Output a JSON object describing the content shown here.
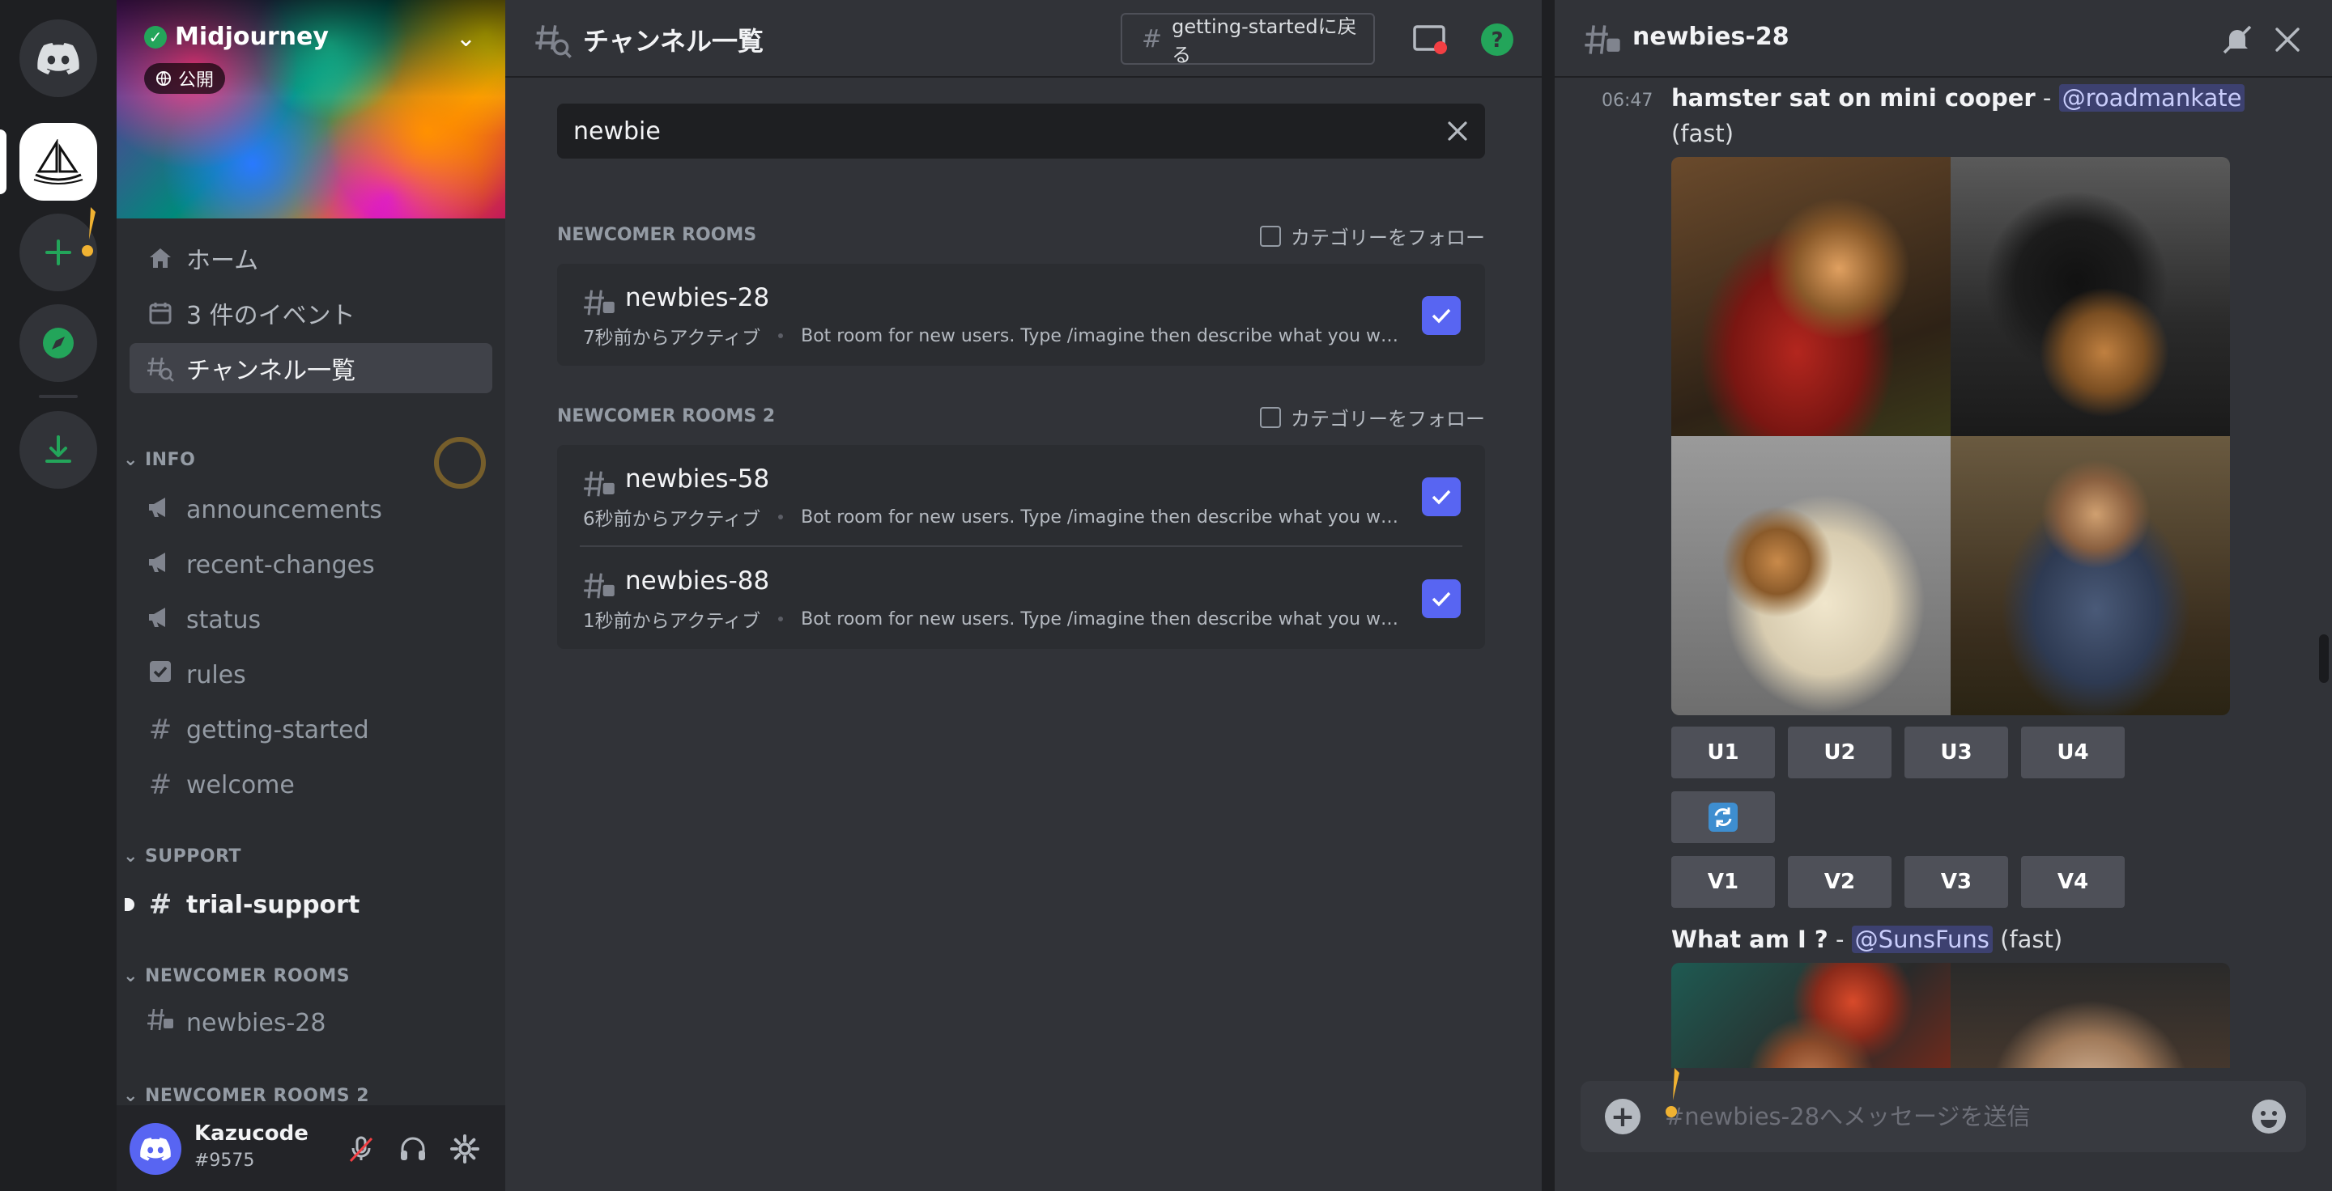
{
  "server": {
    "name": "Midjourney",
    "public_label": "公開"
  },
  "sidebar": {
    "nav": [
      {
        "label": "ホーム",
        "icon": "home-icon"
      },
      {
        "label": "3 件のイベント",
        "icon": "calendar-icon"
      },
      {
        "label": "チャンネル一覧",
        "icon": "channel-browse-icon",
        "selected": true
      }
    ],
    "categories": {
      "info": "INFO",
      "support": "SUPPORT",
      "newcomer": "NEWCOMER ROOMS",
      "newcomer2": "NEWCOMER ROOMS 2"
    },
    "info_channels": [
      {
        "label": "announcements",
        "icon": "megaphone-icon"
      },
      {
        "label": "recent-changes",
        "icon": "megaphone-icon"
      },
      {
        "label": "status",
        "icon": "megaphone-icon"
      },
      {
        "label": "rules",
        "icon": "rules-checkbox-icon"
      },
      {
        "label": "getting-started",
        "icon": "hash-icon"
      },
      {
        "label": "welcome",
        "icon": "hash-icon"
      }
    ],
    "support_channels": [
      {
        "label": "trial-support",
        "icon": "hash-icon",
        "unread": true
      }
    ],
    "newcomer_channels": [
      {
        "label": "newbies-28",
        "icon": "thread-hash-icon"
      }
    ]
  },
  "user": {
    "name": "Kazucode",
    "tag": "#9575"
  },
  "browser": {
    "title": "チャンネル一覧",
    "back_button": "getting-startedに戻る",
    "search_value": "newbie",
    "follow_label": "カテゴリーをフォロー",
    "sections": [
      {
        "title": "NEWCOMER ROOMS",
        "rows": [
          {
            "name": "newbies-28",
            "activity": "7秒前からアクティブ",
            "description": "Bot room for new users. Type /imagine then describe what you want to ...",
            "checked": true
          }
        ]
      },
      {
        "title": "NEWCOMER ROOMS 2",
        "rows": [
          {
            "name": "newbies-58",
            "activity": "6秒前からアクティブ",
            "description": "Bot room for new users. Type /imagine then describe what you want to...",
            "checked": true
          },
          {
            "name": "newbies-88",
            "activity": "1秒前からアクティブ",
            "description": "Bot room for new users. Type /imagine then describe what you want to ...",
            "checked": true
          }
        ]
      }
    ]
  },
  "thread": {
    "title": "newbies-28",
    "messages": [
      {
        "time": "06:47",
        "prompt": "hamster sat on mini cooper",
        "sep": " - ",
        "mention": "@roadmankate",
        "mode": "(fast)"
      },
      {
        "time": "",
        "prompt": "What am I ?",
        "sep": " - ",
        "mention": "@SunsFuns",
        "mode": "(fast)"
      }
    ],
    "upscale_buttons": [
      "U1",
      "U2",
      "U3",
      "U4"
    ],
    "variation_buttons": [
      "V1",
      "V2",
      "V3",
      "V4"
    ],
    "composer_placeholder": "#newbies-28へメッセージを送信"
  },
  "colors": {
    "accent": "#5865f2",
    "rail": "#1e1f22",
    "sidebar": "#2b2d31",
    "main": "#313338",
    "online": "#23a55a"
  }
}
